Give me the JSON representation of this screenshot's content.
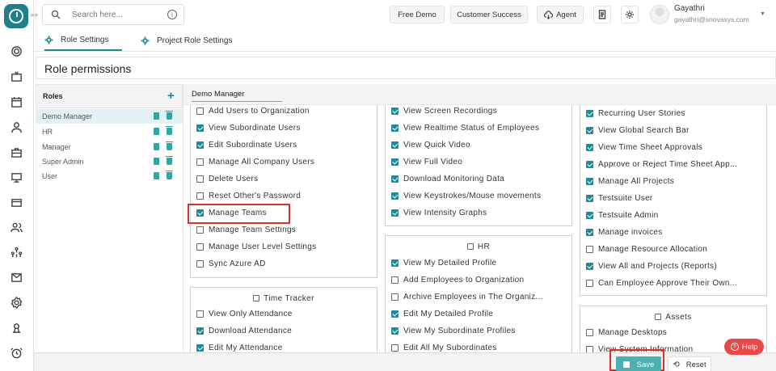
{
  "topbar": {
    "search_placeholder": "Search here...",
    "info_glyph": "i",
    "free_demo": "Free Demo",
    "customer_success": "Customer Success",
    "agent": "Agent",
    "user_name": "Gayathri",
    "user_email": "gayathri@snovasys.com"
  },
  "tabs": [
    {
      "label": "Role Settings",
      "active": true
    },
    {
      "label": "Project Role Settings",
      "active": false
    }
  ],
  "page_title": "Role permissions",
  "roles": {
    "header": "Roles",
    "add_glyph": "+",
    "items": [
      {
        "name": "Demo Manager",
        "selected": true
      },
      {
        "name": "HR"
      },
      {
        "name": "Manager"
      },
      {
        "name": "Super Admin"
      },
      {
        "name": "User"
      }
    ]
  },
  "selected_role": "Demo Manager",
  "columns": {
    "col1": {
      "items": [
        {
          "label": "Add Users to Organization",
          "checked": false
        },
        {
          "label": "View Subordinate Users",
          "checked": true
        },
        {
          "label": "Edit Subordinate Users",
          "checked": true
        },
        {
          "label": "Manage All Company Users",
          "checked": false
        },
        {
          "label": "Delete Users",
          "checked": false
        },
        {
          "label": "Reset Other's Password",
          "checked": false
        },
        {
          "label": "Manage Teams",
          "checked": true
        },
        {
          "label": "Manage Team Settings",
          "checked": false
        },
        {
          "label": "Manage User Level Settings",
          "checked": false
        },
        {
          "label": "Sync Azure AD",
          "checked": false
        }
      ]
    },
    "time_tracker": {
      "title": "Time Tracker",
      "items": [
        {
          "label": "View Only Attendance",
          "checked": false
        },
        {
          "label": "Download Attendance",
          "checked": true
        },
        {
          "label": "Edit My Attendance",
          "checked": true
        }
      ]
    },
    "col2": {
      "items": [
        {
          "label": "View Screen Recordings",
          "checked": true
        },
        {
          "label": "View Realtime Status of Employees",
          "checked": true
        },
        {
          "label": "View Quick Video",
          "checked": true
        },
        {
          "label": "View Full Video",
          "checked": true
        },
        {
          "label": "Download Monitoring Data",
          "checked": true
        },
        {
          "label": "View Keystrokes/Mouse movements",
          "checked": true
        },
        {
          "label": "View Intensity Graphs",
          "checked": true
        }
      ]
    },
    "hr": {
      "title": "HR",
      "items": [
        {
          "label": "View My Detailed Profile",
          "checked": true
        },
        {
          "label": "Add Employees to Organization",
          "checked": false
        },
        {
          "label": "Archive Employees in The Organiz...",
          "checked": false
        },
        {
          "label": "Edit My Detailed Profile",
          "checked": true
        },
        {
          "label": "View My Subordinate Profiles",
          "checked": true
        },
        {
          "label": "Edit All My Subordinates",
          "checked": false
        }
      ]
    },
    "col3": {
      "items": [
        {
          "label": "Recurring User Stories",
          "checked": true
        },
        {
          "label": "View Global Search Bar",
          "checked": true
        },
        {
          "label": "View Time Sheet Approvals",
          "checked": true
        },
        {
          "label": "Approve or Reject Time Sheet App...",
          "checked": true
        },
        {
          "label": "Manage All Projects",
          "checked": true
        },
        {
          "label": "Testsuite User",
          "checked": true
        },
        {
          "label": "Testsuite Admin",
          "checked": true
        },
        {
          "label": "Manage invoices",
          "checked": true
        },
        {
          "label": "Manage Resource Allocation",
          "checked": false
        },
        {
          "label": "View All and Projects (Reports)",
          "checked": true
        },
        {
          "label": "Can Employee Approve Their Own...",
          "checked": false
        }
      ]
    },
    "assets": {
      "title": "Assets",
      "items": [
        {
          "label": "Manage Desktops",
          "checked": false
        },
        {
          "label": "View System Information",
          "checked": false
        }
      ]
    }
  },
  "help_label": "Help",
  "help_glyph": "?",
  "save_label": "Save",
  "reset_label": "Reset",
  "reset_glyph": "⟲",
  "colors": {
    "accent": "#1f8a8a",
    "highlight": "#d9312b",
    "help": "#e84a4a",
    "save": "#4ab0b0"
  }
}
